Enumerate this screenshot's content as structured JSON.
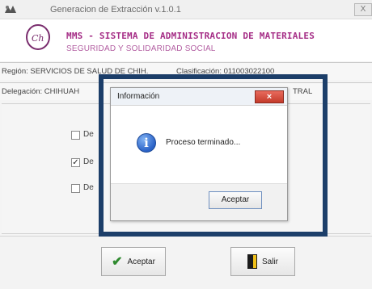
{
  "window": {
    "title": "Generacion de Extracción v.1.0.1",
    "close_label": "X"
  },
  "header": {
    "system_title": "MMS - SISTEMA DE ADMINISTRACION DE MATERIALES",
    "system_subtitle": "SEGURIDAD Y SOLIDARIDAD SOCIAL"
  },
  "info": {
    "region": "Región: SERVICIOS DE SALUD DE CHIH.",
    "clasificacion": "Clasificación: 011003022100",
    "delegacion": "Delegación: CHIHUAH",
    "delegacion_tail": "TRAL"
  },
  "options": [
    {
      "checked": false,
      "label": "De"
    },
    {
      "checked": true,
      "label": "De"
    },
    {
      "checked": false,
      "label": "De"
    }
  ],
  "buttons": {
    "accept": "Aceptar",
    "exit": "Salir"
  },
  "dialog": {
    "title": "Información",
    "message": "Proceso terminado...",
    "ok_label": "Aceptar",
    "close_label": "×"
  },
  "colors": {
    "highlight": "#1c3e69",
    "title_purple": "#a52d86",
    "info_blue": "#2a62c7"
  }
}
